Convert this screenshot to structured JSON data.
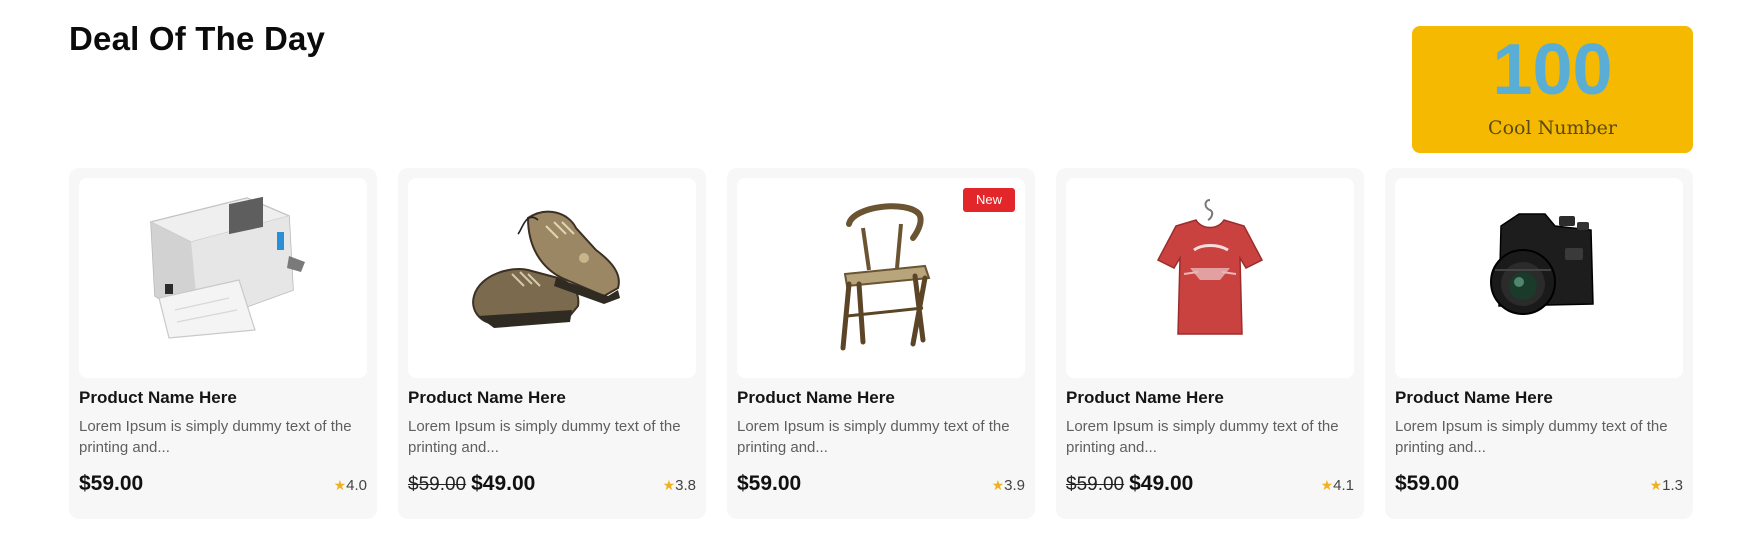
{
  "section": {
    "title": "Deal Of The Day"
  },
  "stat": {
    "number": "100",
    "label": "Cool Number",
    "colors": {
      "background": "#f4b900",
      "number": "#5aaed6"
    }
  },
  "products": [
    {
      "image": "printer",
      "badge": null,
      "name": "Product Name Here",
      "description": "Lorem Ipsum is simply dummy text of the printing and...",
      "old_price": null,
      "price": "$59.00",
      "rating": "4.0"
    },
    {
      "image": "hiking-shoes",
      "badge": null,
      "name": "Product Name Here",
      "description": "Lorem Ipsum is simply dummy text of the printing and...",
      "old_price": "$59.00",
      "price": "$49.00",
      "rating": "3.8"
    },
    {
      "image": "wooden-chair",
      "badge": "New",
      "name": "Product Name Here",
      "description": "Lorem Ipsum is simply dummy text of the printing and...",
      "old_price": null,
      "price": "$59.00",
      "rating": "3.9"
    },
    {
      "image": "red-tshirt",
      "badge": null,
      "name": "Product Name Here",
      "description": "Lorem Ipsum is simply dummy text of the printing and...",
      "old_price": "$59.00",
      "price": "$49.00",
      "rating": "4.1"
    },
    {
      "image": "camera",
      "badge": null,
      "name": "Product Name Here",
      "description": "Lorem Ipsum is simply dummy text of the printing and...",
      "old_price": null,
      "price": "$59.00",
      "rating": "1.3"
    }
  ],
  "icons": {
    "star": "★"
  },
  "colors": {
    "badge": "#e32629",
    "star": "#f2b01e",
    "card_background": "#f7f7f7"
  }
}
